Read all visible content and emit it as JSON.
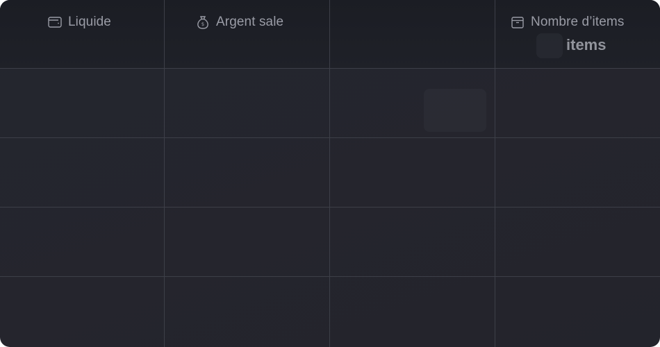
{
  "table": {
    "columns": [
      {
        "label": "Liquide",
        "icon": "wallet-icon"
      },
      {
        "label": "Argent sale",
        "icon": "money-bag-icon"
      },
      {
        "label": "",
        "icon": ""
      },
      {
        "label": "Nombre d’items",
        "icon": "box-icon"
      }
    ],
    "overlay_label": "items",
    "row_count": 4
  },
  "colors": {
    "background": "#23252d",
    "header": "#1c1e25",
    "grid_line": "#3d3f48",
    "header_text": "#9a9ca6"
  }
}
